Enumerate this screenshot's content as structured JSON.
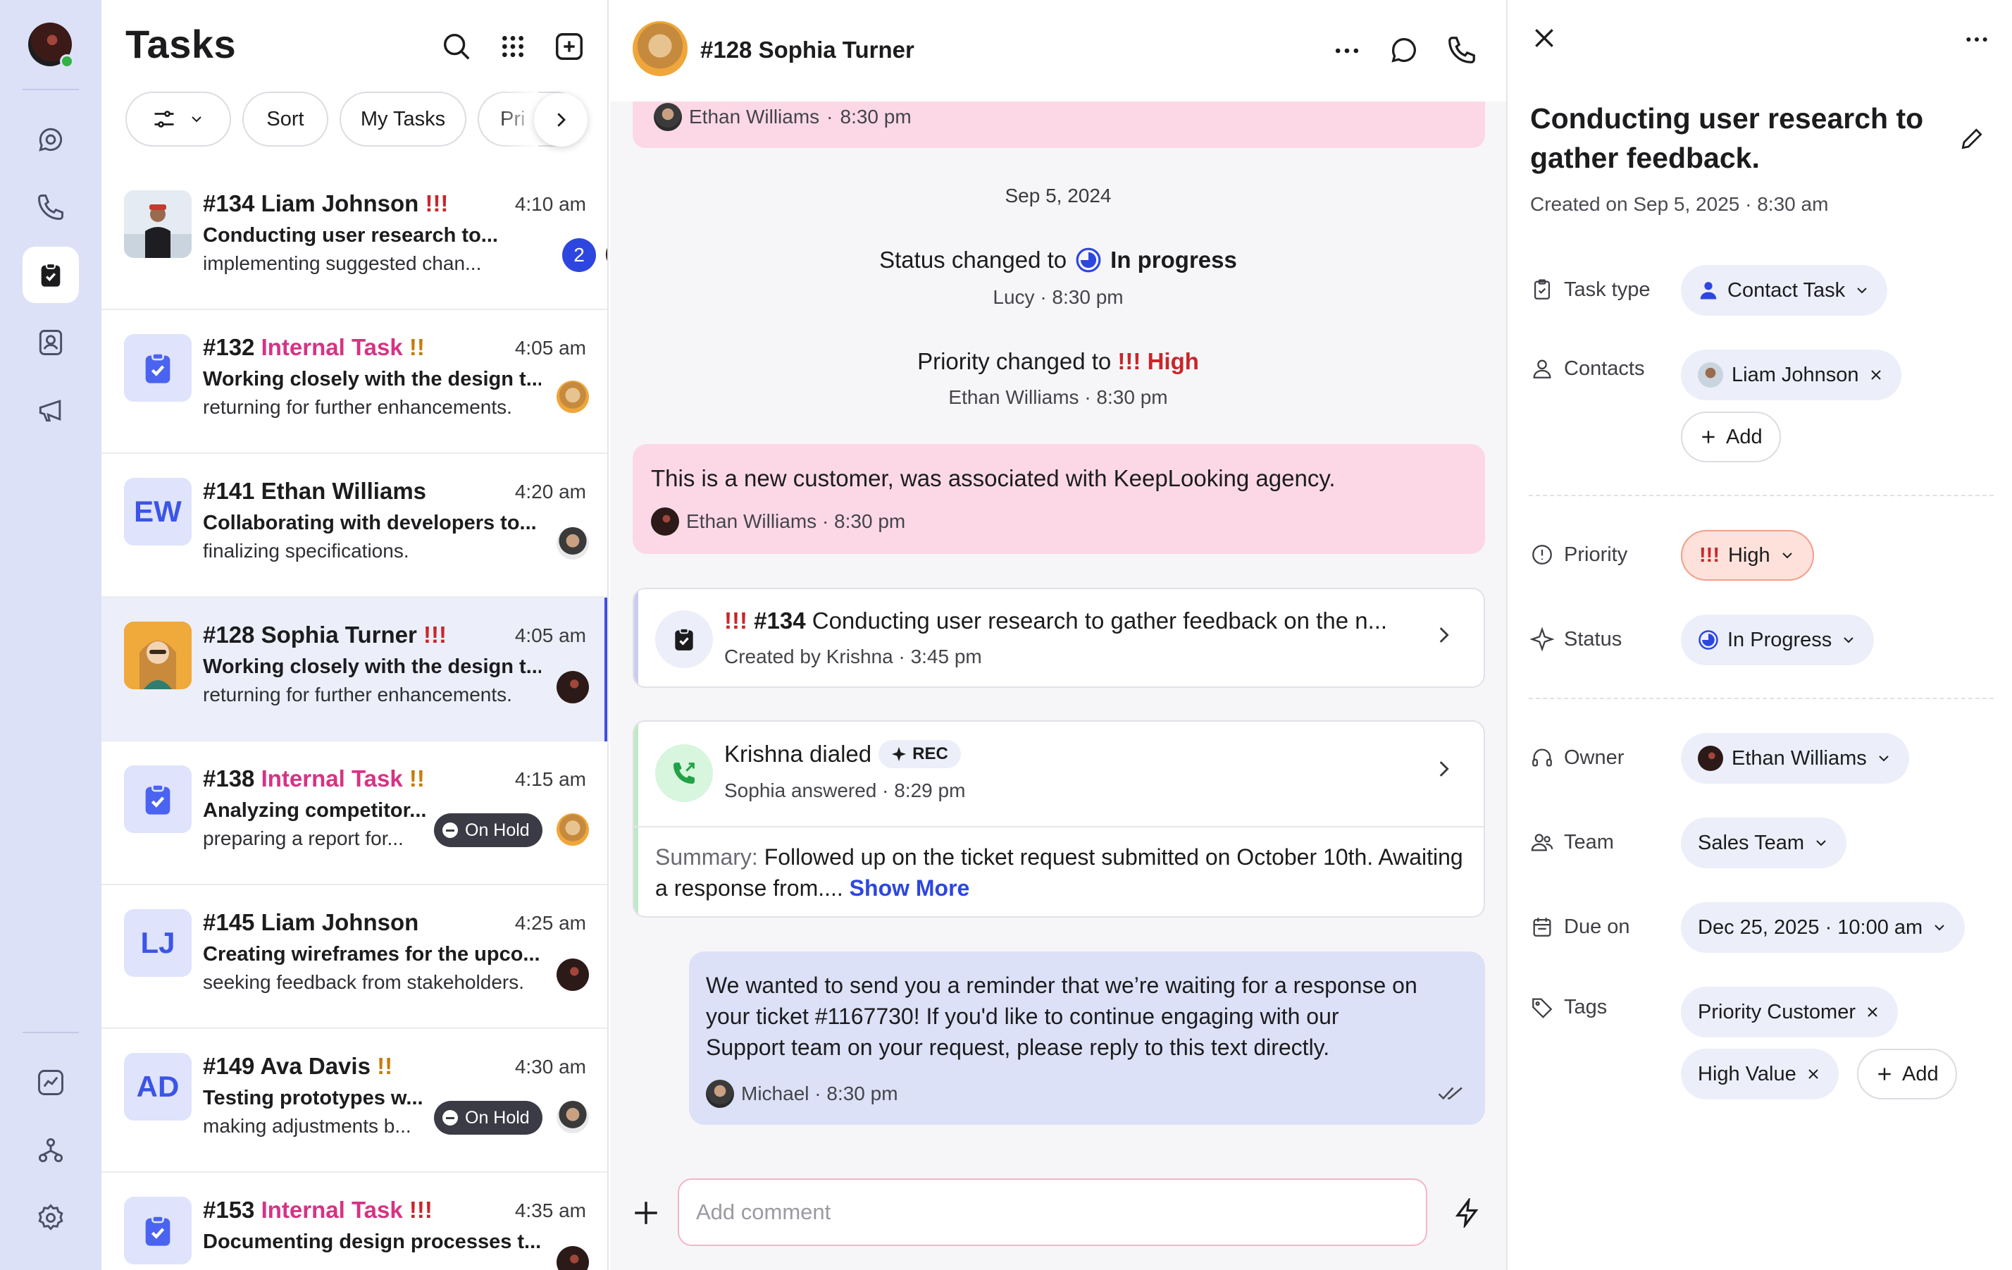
{
  "nav": {
    "items": [
      "inbox-icon",
      "phone-icon",
      "tasks-icon",
      "contacts-icon",
      "campaigns-icon"
    ],
    "bottom": [
      "analytics-icon",
      "workflows-icon",
      "settings-icon"
    ]
  },
  "list": {
    "title": "Tasks",
    "filters": {
      "sort": "Sort",
      "my_tasks": "My Tasks",
      "partial": "Pri"
    },
    "tasks": [
      {
        "id": "#134",
        "name": "Liam Johnson",
        "marks": "!!!",
        "time": "4:10 am",
        "line1": "Conducting user research to...",
        "line2": "implementing suggested chan...",
        "count": "2"
      },
      {
        "id": "#132",
        "name": "Internal Task",
        "marks": "!!",
        "time": "4:05 am",
        "line1": "Working closely with the design t...",
        "line2": "returning for further enhancements."
      },
      {
        "id": "#141",
        "name": "Ethan Williams",
        "marks": "",
        "time": "4:20 am",
        "initials": "EW",
        "line1": "Collaborating with developers to...",
        "line2": "finalizing specifications."
      },
      {
        "id": "#128",
        "name": "Sophia Turner",
        "marks": "!!!",
        "time": "4:05 am",
        "line1": "Working closely with the design t...",
        "line2": "returning for further enhancements."
      },
      {
        "id": "#138",
        "name": "Internal Task",
        "marks": "!!",
        "time": "4:15 am",
        "line1": "Analyzing competitor...",
        "line2": "preparing a report for...",
        "badge": "On Hold"
      },
      {
        "id": "#145",
        "name": "Liam Johnson",
        "marks": "",
        "time": "4:25 am",
        "initials": "LJ",
        "line1": "Creating wireframes for the upco...",
        "line2": "seeking feedback from stakeholders."
      },
      {
        "id": "#149",
        "name": "Ava Davis",
        "marks": "!!",
        "time": "4:30 am",
        "initials": "AD",
        "line1": "Testing prototypes w...",
        "line2": "making adjustments b...",
        "badge": "On Hold"
      },
      {
        "id": "#153",
        "name": "Internal Task",
        "marks": "!!!",
        "time": "4:35 am",
        "line1": "Documenting design processes t...",
        "line2": ""
      }
    ]
  },
  "conversation": {
    "header": {
      "title": "#128 Sophia Turner"
    },
    "top_meta": {
      "author": "Ethan Williams",
      "time": "8:30 pm"
    },
    "date": "Sep 5, 2024",
    "status_change": {
      "prefix": "Status changed to",
      "value": "In progress",
      "meta": "Lucy · 8:30 pm"
    },
    "priority_change": {
      "prefix": "Priority changed to",
      "marks": "!!!",
      "value": "High",
      "meta": "Ethan Williams · 8:30 pm"
    },
    "note": {
      "text": "This is a new customer, was associated with KeepLooking agency.",
      "meta": "Ethan Williams · 8:30 pm"
    },
    "linked_task": {
      "marks": "!!!",
      "id": "#134",
      "text": "Conducting user research to gather feedback on the n...",
      "meta": "Created by Krishna · 3:45 pm"
    },
    "call": {
      "title": "Krishna dialed",
      "rec": "REC",
      "meta": "Sophia answered · 8:29 pm",
      "summary_label": "Summary:",
      "summary": "Followed up on the ticket request submitted on October 10th. Awaiting a response from....",
      "show_more": "Show More"
    },
    "outgoing": {
      "line1": "We wanted to send you a reminder that we’re waiting for a response on",
      "line2": "your ticket #1167730! If you'd like to continue engaging with our",
      "line3": "Support team on your request, please reply to this text directly.",
      "meta": "Michael · 8:30 pm"
    },
    "composer": {
      "placeholder": "Add comment"
    }
  },
  "detail": {
    "title": "Conducting user research to gather feedback.",
    "created": "Created on Sep 5, 2025 · 8:30 am",
    "fields": {
      "task_type": {
        "label": "Task type",
        "value": "Contact Task"
      },
      "contacts": {
        "label": "Contacts",
        "value": "Liam Johnson",
        "add": "Add"
      },
      "priority": {
        "label": "Priority",
        "marks": "!!!",
        "value": "High"
      },
      "status": {
        "label": "Status",
        "value": "In Progress"
      },
      "owner": {
        "label": "Owner",
        "value": "Ethan Williams"
      },
      "team": {
        "label": "Team",
        "value": "Sales Team"
      },
      "due": {
        "label": "Due on",
        "value": "Dec 25, 2025 · 10:00 am"
      },
      "tags": {
        "label": "Tags",
        "items": [
          "Priority Customer",
          "High Value"
        ],
        "add": "Add"
      }
    }
  },
  "colors": {
    "accent": "#2d46e0",
    "rail_bg": "#dde1f7",
    "note_pink": "#fcd8e6",
    "priority_red": "#c8262a",
    "internal_magenta": "#d63384",
    "call_green": "#6fd08a"
  }
}
